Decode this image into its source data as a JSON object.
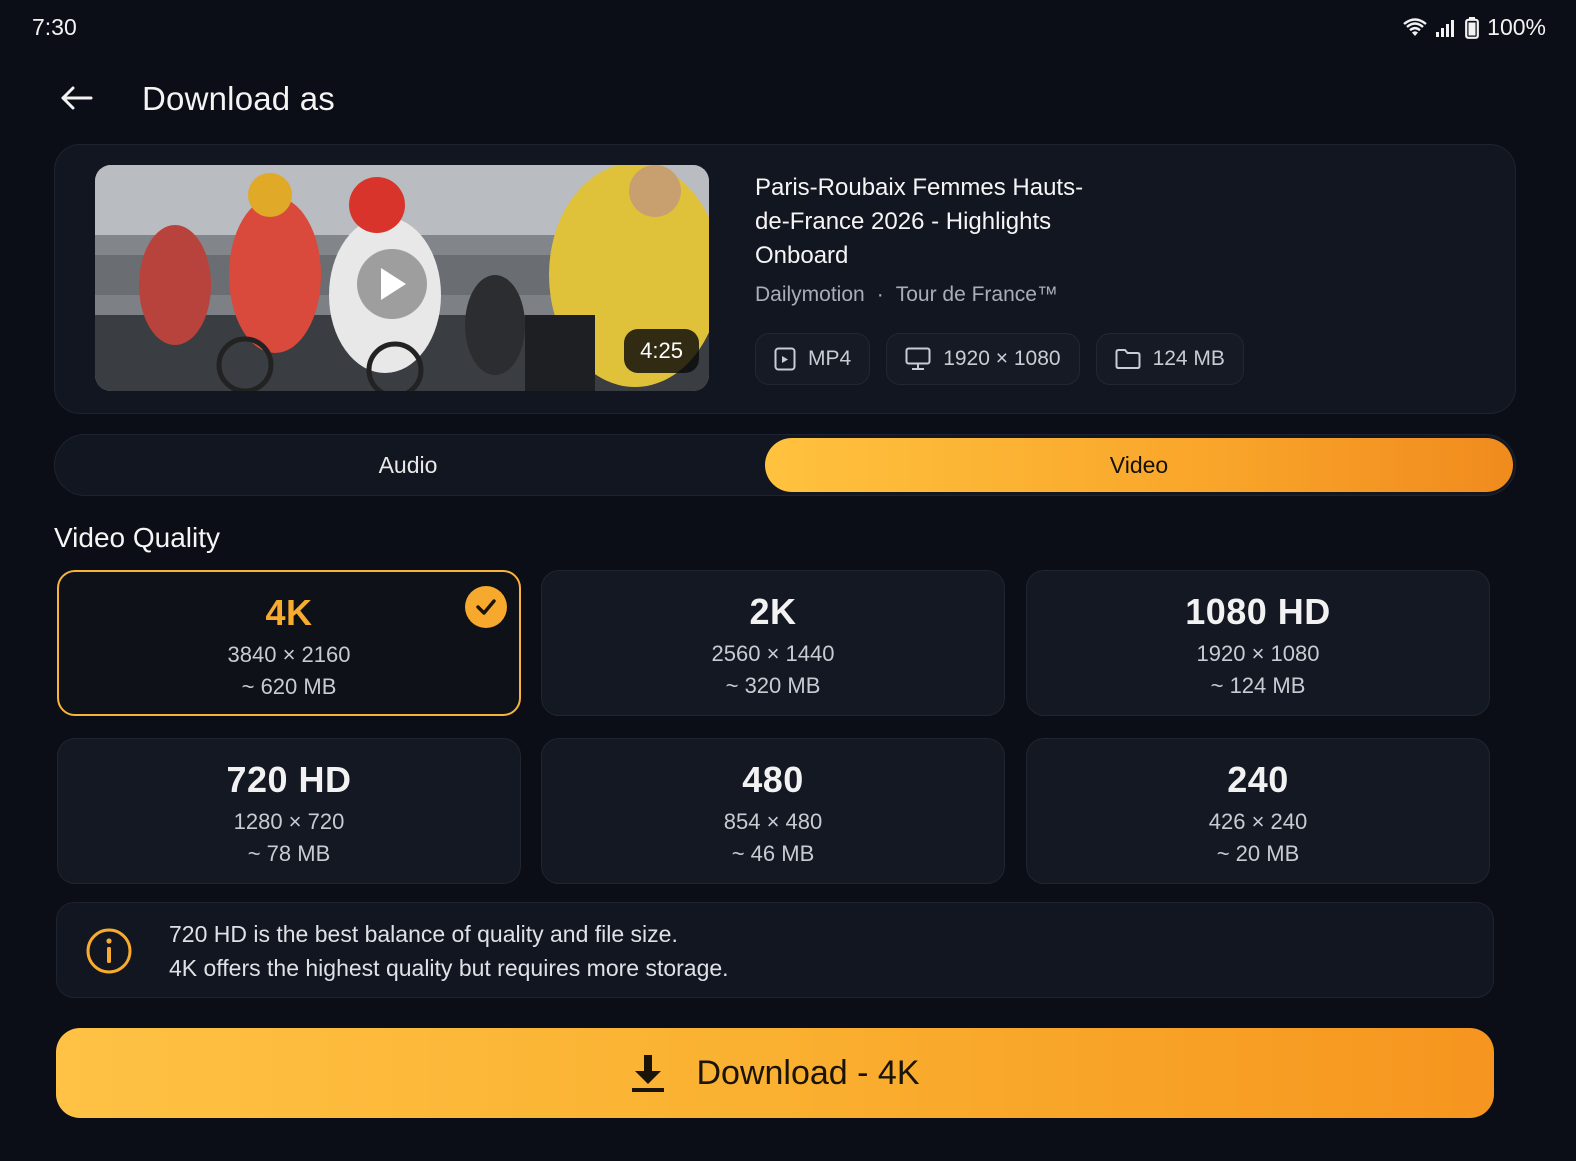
{
  "status_bar": {
    "time": "7:30",
    "battery": "100%"
  },
  "header": {
    "title": "Download as"
  },
  "media": {
    "title": "Paris-Roubaix Femmes Hauts-de-France 2026 - Highlights Onboard",
    "source": "Dailymotion",
    "separator": "·",
    "channel": "Tour de France™",
    "duration": "4:25",
    "chips": {
      "format": "MP4",
      "resolution": "1920 × 1080",
      "size": "124 MB"
    }
  },
  "tabs": {
    "audio": "Audio",
    "video": "Video",
    "active": "Video"
  },
  "section": {
    "title": "Video Quality"
  },
  "qualities": [
    {
      "name": "4K",
      "resolution": "3840 × 2160",
      "size": "~ 620 MB",
      "selected": true
    },
    {
      "name": "2K",
      "resolution": "2560 × 1440",
      "size": "~ 320 MB",
      "selected": false
    },
    {
      "name": "1080 HD",
      "resolution": "1920 × 1080",
      "size": "~ 124 MB",
      "selected": false
    },
    {
      "name": "720 HD",
      "resolution": "1280 × 720",
      "size": "~ 78 MB",
      "selected": false
    },
    {
      "name": "480",
      "resolution": "854 × 480",
      "size": "~ 46 MB",
      "selected": false
    },
    {
      "name": "240",
      "resolution": "426 × 240",
      "size": "~ 20 MB",
      "selected": false
    }
  ],
  "info": {
    "line1": "720 HD is the best balance of quality and file size.",
    "line2": "4K offers the highest quality but requires more storage."
  },
  "download_button": {
    "label": "Download - 4K"
  },
  "icons": {
    "back": "arrow-left-icon",
    "wifi": "wifi-icon",
    "signal": "signal-icon",
    "battery": "battery-icon",
    "play": "play-icon",
    "format": "file-video-icon",
    "resolution": "monitor-icon",
    "size": "folder-icon",
    "check": "check-icon",
    "info": "info-icon",
    "download": "download-icon"
  },
  "colors": {
    "accent": "#f8ab2d",
    "background": "#0b0e16",
    "card": "#141822"
  }
}
